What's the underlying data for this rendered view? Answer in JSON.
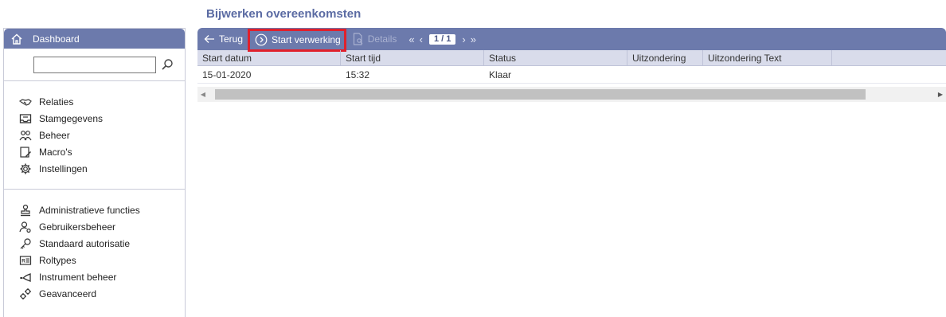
{
  "page": {
    "title": "Bijwerken overeenkomsten"
  },
  "sidebar": {
    "header_label": "Dashboard",
    "search": {
      "value": "",
      "placeholder": ""
    },
    "group1": [
      {
        "label": "Relaties",
        "icon": "handshake-icon"
      },
      {
        "label": "Stamgegevens",
        "icon": "tray-icon"
      },
      {
        "label": "Beheer",
        "icon": "people-icon"
      },
      {
        "label": "Macro's",
        "icon": "macro-edit-icon"
      },
      {
        "label": "Instellingen",
        "icon": "gear-icon"
      }
    ],
    "group2": [
      {
        "label": "Administratieve functies",
        "icon": "stamp-icon"
      },
      {
        "label": "Gebruikersbeheer",
        "icon": "user-settings-icon"
      },
      {
        "label": "Standaard autorisatie",
        "icon": "key-icon"
      },
      {
        "label": "Roltypes",
        "icon": "id-card-icon"
      },
      {
        "label": "Instrument beheer",
        "icon": "instrument-icon"
      },
      {
        "label": "Geavanceerd",
        "icon": "gears-icon"
      }
    ]
  },
  "toolbar": {
    "back_label": "Terug",
    "start_label": "Start verwerking",
    "details_label": "Details",
    "pager_text": "1 / 1"
  },
  "table": {
    "headers": [
      "Start datum",
      "Start tijd",
      "Status",
      "Uitzondering",
      "Uitzondering Text",
      ""
    ],
    "rows": [
      [
        "15-01-2020",
        "15:32",
        "Klaar",
        "",
        "",
        ""
      ]
    ]
  },
  "colors": {
    "accent": "#6c7aac",
    "highlight": "#e0202c",
    "title": "#5b6ba3"
  }
}
